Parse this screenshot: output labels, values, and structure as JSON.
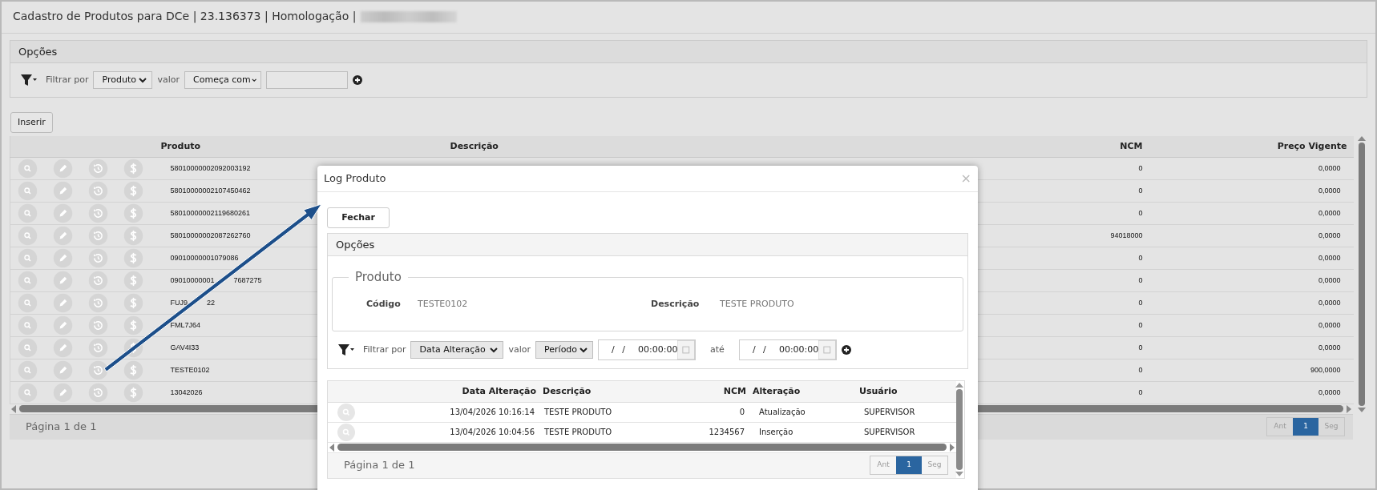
{
  "header": {
    "title": "Cadastro de Produtos para DCe | 23.136373 | Homologação |"
  },
  "options": {
    "title": "Opções",
    "filter": {
      "label": "Filtrar por",
      "field": "Produto",
      "value_label": "valor",
      "operator": "Começa com"
    }
  },
  "insert_button": "Inserir",
  "table": {
    "columns": [
      "Produto",
      "Descrição",
      "NCM",
      "Preço Vigente"
    ],
    "rows": [
      {
        "produto": [
          "58010000002092003192"
        ],
        "ncm": "0",
        "preco": "0,0000"
      },
      {
        "produto": [
          "58010000002107450462"
        ],
        "ncm": "0",
        "preco": "0,0000"
      },
      {
        "produto": [
          "58010000002119680261"
        ],
        "ncm": "0",
        "preco": "0,0000"
      },
      {
        "produto": [
          "58010000002087262760"
        ],
        "ncm": "94018000",
        "preco": "0,0000"
      },
      {
        "produto": [
          "09010000001079086"
        ],
        "ncm": "0",
        "preco": "0,0000"
      },
      {
        "produto": [
          "09010000001",
          "7687275"
        ],
        "ncm": "0",
        "preco": "0,0000"
      },
      {
        "produto": [
          "FUJ9",
          "22"
        ],
        "ncm": "0",
        "preco": "0,0000"
      },
      {
        "produto": [
          "FML7J64"
        ],
        "ncm": "0",
        "preco": "0,0000"
      },
      {
        "produto": [
          "GAV4I33"
        ],
        "ncm": "0",
        "preco": "0,0000"
      },
      {
        "produto": [
          "TESTE0102"
        ],
        "ncm": "0",
        "preco": "900,0000"
      },
      {
        "produto": [
          "13042026"
        ],
        "ncm": "0",
        "preco": "0,0000"
      }
    ],
    "pagination": {
      "label": "Página 1 de 1",
      "prev": "Ant",
      "pages": [
        {
          "label": "1",
          "selected": true
        }
      ],
      "next": "Seg"
    }
  },
  "modal": {
    "title": "Log Produto",
    "close": "×",
    "close_button": "Fechar",
    "options_title": "Opções",
    "fieldset": {
      "legend": "Produto",
      "fields": [
        {
          "label": "Código",
          "value": "TESTE0102"
        },
        {
          "label": "Descrição",
          "value": "TESTE PRODUTO"
        }
      ]
    },
    "filter": {
      "label": "Filtrar por",
      "field": "Data Alteração",
      "value_label": "valor",
      "operator": "Período",
      "from": {
        "date": "/ /",
        "time": "00:00:00"
      },
      "to_label": "até",
      "to": {
        "date": "/ /",
        "time": "00:00:00"
      }
    },
    "table": {
      "columns": [
        "Data Alteração",
        "Descrição",
        "NCM",
        "Alteração",
        "Usuário"
      ],
      "rows": [
        [
          "13/04/2026 10:16:14",
          "TESTE PRODUTO",
          "0",
          "Atualização",
          "SUPERVISOR"
        ],
        [
          "13/04/2026 10:04:56",
          "TESTE PRODUTO",
          "1234567",
          "Inserção",
          "SUPERVISOR"
        ]
      ]
    },
    "pagination": {
      "label": "Página 1 de 1",
      "prev": "Ant",
      "pages": [
        {
          "label": "1",
          "selected": true
        }
      ],
      "next": "Seg"
    }
  }
}
